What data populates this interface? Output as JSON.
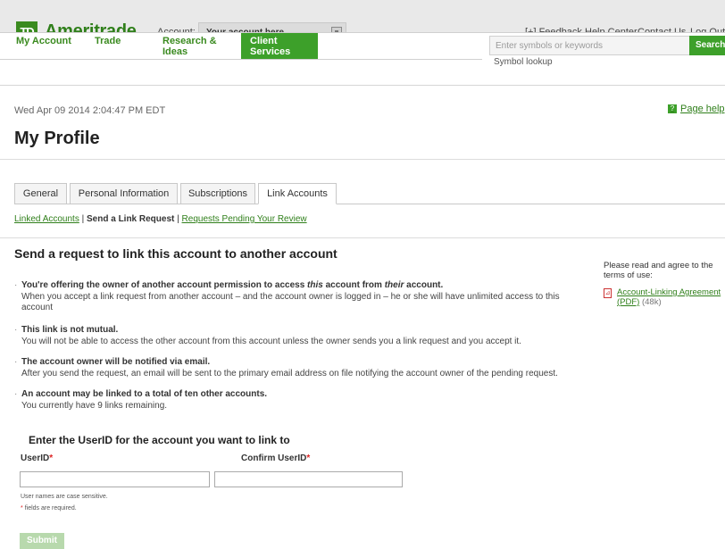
{
  "header": {
    "logo_mark": "TD",
    "logo_text": "Ameritrade",
    "account_label": "Account:",
    "account_value": "Your account here",
    "feedback": "[+] Feedback",
    "help_center": "Help Center",
    "contact_us": "Contact Us",
    "log_out": "Log Out"
  },
  "nav": {
    "tabs": [
      {
        "label": "My Account"
      },
      {
        "label": "Trade"
      },
      {
        "label_line1": "Research &",
        "label_line2": "Ideas"
      },
      {
        "label_line1": "Client",
        "label_line2": "Services"
      }
    ],
    "search_placeholder": "Enter symbols or keywords",
    "search_button": "Search",
    "symbol_lookup": "Symbol lookup"
  },
  "page": {
    "datetime": "Wed Apr 09 2014 2:04:47 PM EDT",
    "page_help": "Page help",
    "title": "My Profile"
  },
  "tabs": [
    {
      "label": "General"
    },
    {
      "label": "Personal Information"
    },
    {
      "label": "Subscriptions"
    },
    {
      "label": "Link Accounts"
    }
  ],
  "sublinks": {
    "linked_accounts": "Linked Accounts",
    "sep1": "|",
    "send_request": "Send a Link Request",
    "sep2": "|",
    "pending": "Requests Pending Your Review"
  },
  "section": {
    "title": "Send a request to link this account to another account",
    "bullets": [
      {
        "head_pre": "You're offering the owner of another account permission to access ",
        "head_em1": "this",
        "head_mid": " account from ",
        "head_em2": "their",
        "head_post": " account.",
        "body": "When you accept a link request from another account – and the account owner is logged in – he or she will have unlimited access to this account"
      },
      {
        "head": "This link is not mutual.",
        "body": "You will not be able to access the other account from this account unless the owner sends you a link request and you accept it."
      },
      {
        "head": "The account owner will be notified via email.",
        "body": "After you send the request, an email will be sent to the primary email address on file notifying the account owner of the pending request."
      },
      {
        "head": "An account may be linked to a total of ten other accounts.",
        "body": "You currently have 9 links remaining."
      }
    ]
  },
  "sidebar": {
    "intro": "Please read and agree to the terms of use:",
    "link": "Account-Linking Agreement (PDF)",
    "size": "(48k)"
  },
  "form": {
    "title": "Enter the UserID for the account you want to link to",
    "userid_label": "UserID",
    "confirm_label": "Confirm UserID",
    "required_mark": "*",
    "note_case": "User names are case sensitive.",
    "note_required": "fields are required.",
    "submit": "Submit"
  },
  "colors": {
    "brand_green": "#3da02a",
    "link_green": "#2f7f1a",
    "required_red": "#d22222"
  }
}
